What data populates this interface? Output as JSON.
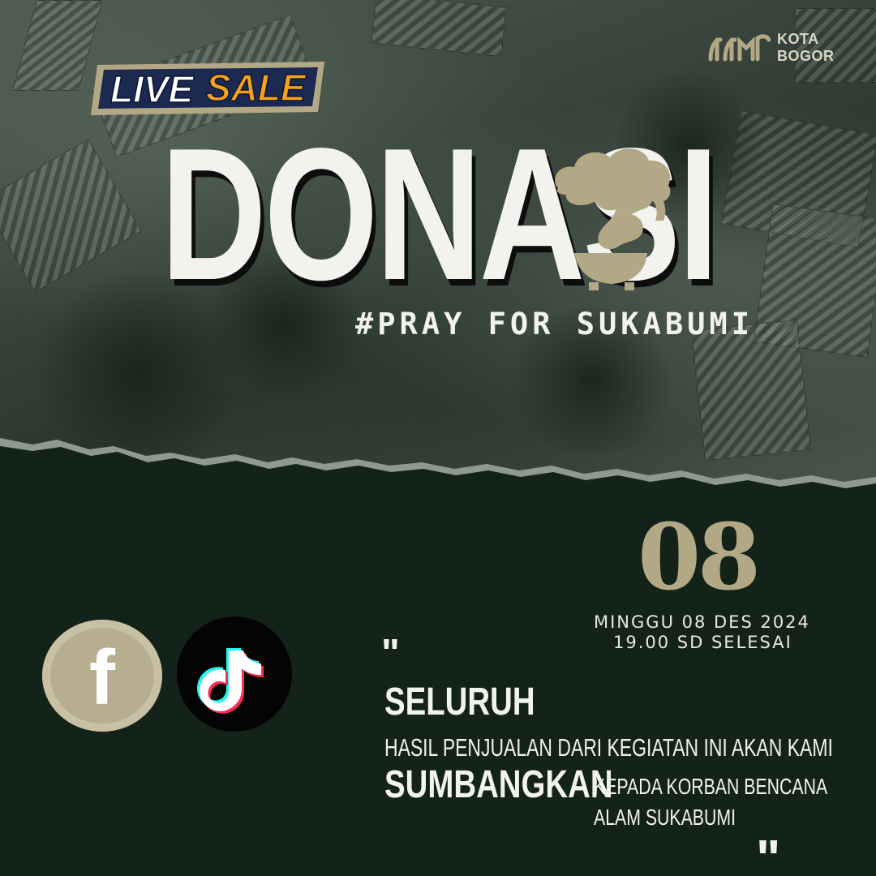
{
  "header": {
    "logo_line1": "KOTA",
    "logo_line2": "BOGOR",
    "badge_word1": "LIVE",
    "badge_word2": "SALE"
  },
  "hero": {
    "title": "DONASI",
    "hashtag": "#PRAY FOR SUKABUMI"
  },
  "event": {
    "day": "08",
    "date_line": "MINGGU 08 DES 2024",
    "time_line": "19.00 SD SELESAI"
  },
  "social": {
    "facebook_letter": "f"
  },
  "message": {
    "quote_open": "\"",
    "quote_close": "\"",
    "emphasis1": "SELURUH",
    "line1": "HASIL PENJUALAN DARI KEGIATAN INI AKAN KAMI",
    "emphasis2": "SUMBANGKAN",
    "line2": "KEPADA KORBAN BENCANA",
    "line3": "ALAM SUKABUMI"
  },
  "colors": {
    "background": "#142319",
    "accent_gold": "#b3a886",
    "badge_orange": "#f5a21a",
    "text_light": "#f2f2ef"
  },
  "icons": [
    "facebook-icon",
    "tiktok-icon",
    "bonsai-icon",
    "logo-icon"
  ]
}
